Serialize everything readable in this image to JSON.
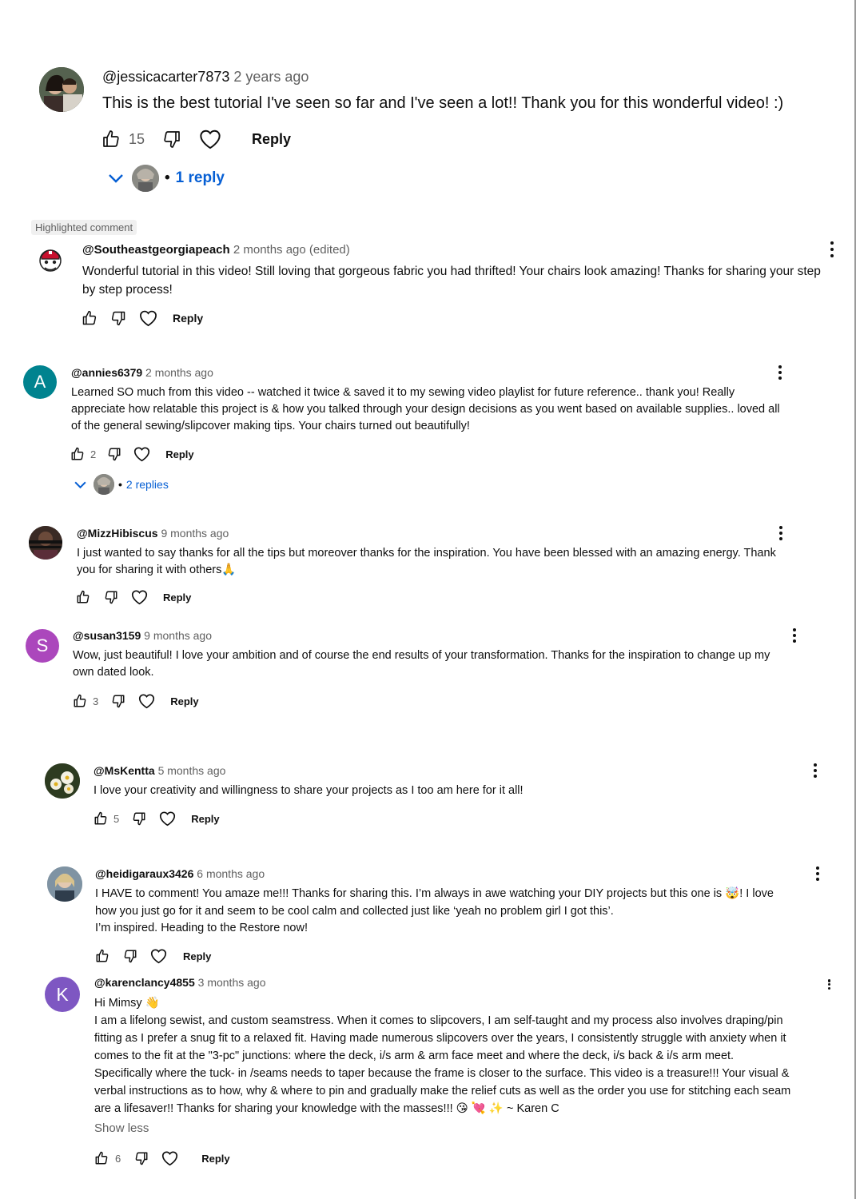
{
  "colors": {
    "link": "#065fd4",
    "secondary": "#606060",
    "avatar_a": "#00838f",
    "avatar_s": "#ab47bc",
    "avatar_k": "#7e57c2"
  },
  "comments": [
    {
      "author": "@jessicacarter7873",
      "time": "2 years ago",
      "lines": [
        "This is the best tutorial I've seen so far and I've seen a lot!! Thank you for this wonderful video! :)"
      ],
      "likes": "15",
      "reply_label": "Reply",
      "replies_label": "1 reply"
    },
    {
      "badge": "Highlighted comment",
      "author": "@Southeastgeorgiapeach",
      "time": "2 months ago (edited)",
      "lines": [
        "Wonderful tutorial in this video!  Still loving that gorgeous fabric you had thrifted!  Your chairs look amazing!  Thanks for sharing your step",
        "by step process!"
      ],
      "likes": "",
      "reply_label": "Reply"
    },
    {
      "author": "@annies6379",
      "time": "2 months ago",
      "avatar_letter": "A",
      "lines": [
        "Learned SO much from this video -- watched it twice & saved it to my sewing video playlist for future reference.. thank you! Really",
        "appreciate how relatable this project is & how you talked through your design decisions as you went based on available supplies.. loved all",
        "of the general sewing/slipcover making tips. Your chairs turned out beautifully!"
      ],
      "likes": "2",
      "reply_label": "Reply",
      "replies_label": "2 replies"
    },
    {
      "author": "@MizzHibiscus",
      "time": "9 months ago",
      "lines": [
        "I just wanted to say thanks for all the tips but moreover thanks for the inspiration. You have been blessed with an amazing energy. Thank",
        "you for sharing it with others🙏"
      ],
      "likes": "",
      "reply_label": "Reply"
    },
    {
      "author": "@susan3159",
      "time": "9 months ago",
      "avatar_letter": "S",
      "lines": [
        "Wow, just beautiful! I love your ambition and of course the end results of your transformation. Thanks for the inspiration to change up my",
        "own dated look."
      ],
      "likes": "3",
      "reply_label": "Reply"
    },
    {
      "author": "@MsKentta",
      "time": "5 months ago",
      "lines": [
        "I love your creativity and willingness to share your projects as I too am here for it all!"
      ],
      "likes": "5",
      "reply_label": "Reply"
    },
    {
      "author": "@heidigaraux3426",
      "time": "6 months ago",
      "lines": [
        "I HAVE to comment!  You amaze me!!!  Thanks for sharing this.  I’m always in awe watching your  DIY projects but this one is 🤯!  I love",
        "how you just go for it and seem to be cool calm and collected just like ‘yeah no problem girl I got this’.",
        "I’m inspired.  Heading to the Restore now!"
      ],
      "likes": "",
      "reply_label": "Reply"
    },
    {
      "author": "@karenclancy4855",
      "time": "3 months ago",
      "avatar_letter": "K",
      "lines": [
        "Hi Mimsy 👋",
        "I am a lifelong sewist, and custom seamstress.  When it comes to slipcovers, I am self-taught and my process also involves draping/pin",
        "fitting as I prefer a snug fit to a relaxed fit.   Having made numerous slipcovers over the years, I consistently struggle with anxiety when it",
        "comes to the fit at the \"3-pc\"  junctions:  where the deck, i/s arm & arm face meet and  where the deck, i/s back &  i/s arm meet.",
        "Specifically where the tuck- in /seams needs to taper because the frame is closer to the surface.  This video is a treasure!!!  Your visual &",
        "verbal instructions as to how, why & where to pin and gradually make the relief cuts as well as the order you use for stitching each seam",
        "are a lifesaver!!  Thanks for sharing your knowledge with the masses!!!   😘 💘 ✨ ~ Karen C"
      ],
      "show_less": "Show less",
      "likes": "6",
      "reply_label": "Reply"
    }
  ]
}
